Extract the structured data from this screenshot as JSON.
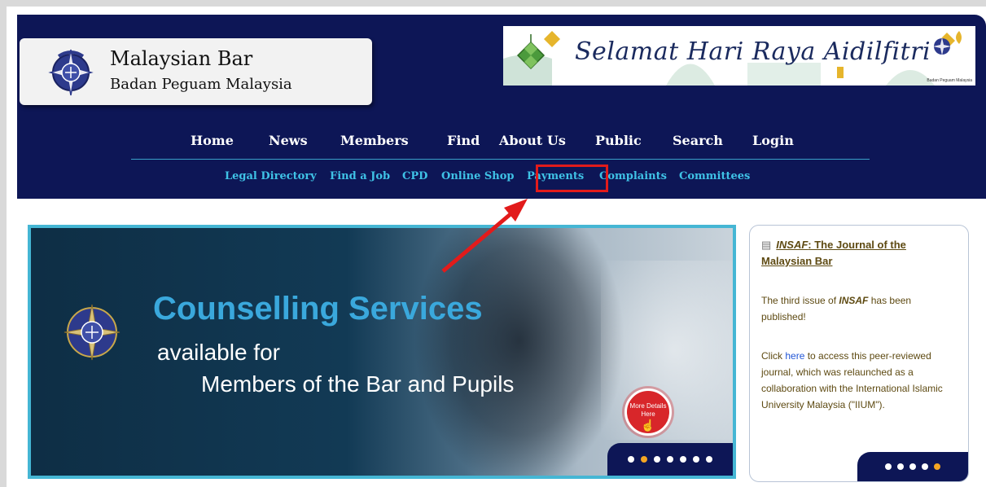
{
  "header": {
    "logo_title": "Malaysian Bar",
    "logo_subtitle": "Badan Peguam Malaysia",
    "banner_text": "Selamat Hari Raya Aidilfitri",
    "banner_caption": "Badan Peguam Malaysia"
  },
  "main_nav": [
    {
      "label": "Home"
    },
    {
      "label": "News"
    },
    {
      "label": "Members"
    },
    {
      "label": "Find"
    },
    {
      "label": "About Us"
    },
    {
      "label": "Public"
    },
    {
      "label": "Search"
    },
    {
      "label": "Login"
    }
  ],
  "sub_nav": [
    {
      "label": "Legal Directory"
    },
    {
      "label": "Find a Job"
    },
    {
      "label": "CPD"
    },
    {
      "label": "Online Shop"
    },
    {
      "label": "Payments"
    },
    {
      "label": "Complaints"
    },
    {
      "label": "Committees"
    }
  ],
  "hero": {
    "title": "Counselling Services",
    "line1": "available for",
    "line2": "Members of the Bar and Pupils",
    "button_line1": "More Details",
    "button_line2": "Here",
    "slide_count": 7,
    "active_slide": 2
  },
  "side_card": {
    "title_em": "INSAF",
    "title_rest": ": The Journal of the Malaysian Bar",
    "p1_pre": "The third issue of ",
    "p1_em": "INSAF",
    "p1_post": " has been published!",
    "p2_pre": "Click ",
    "p2_link": "here",
    "p2_post": " to access this peer-reviewed journal, which was relaunched as a collaboration with the International Islamic University Malaysia (\"IIUM\").",
    "slide_count": 5,
    "active_slide": 5
  },
  "colors": {
    "header_bg": "#0d1656",
    "sub_nav_text": "#3fc2e6",
    "highlight": "#e21b1b",
    "dot_active": "#f5a623"
  }
}
